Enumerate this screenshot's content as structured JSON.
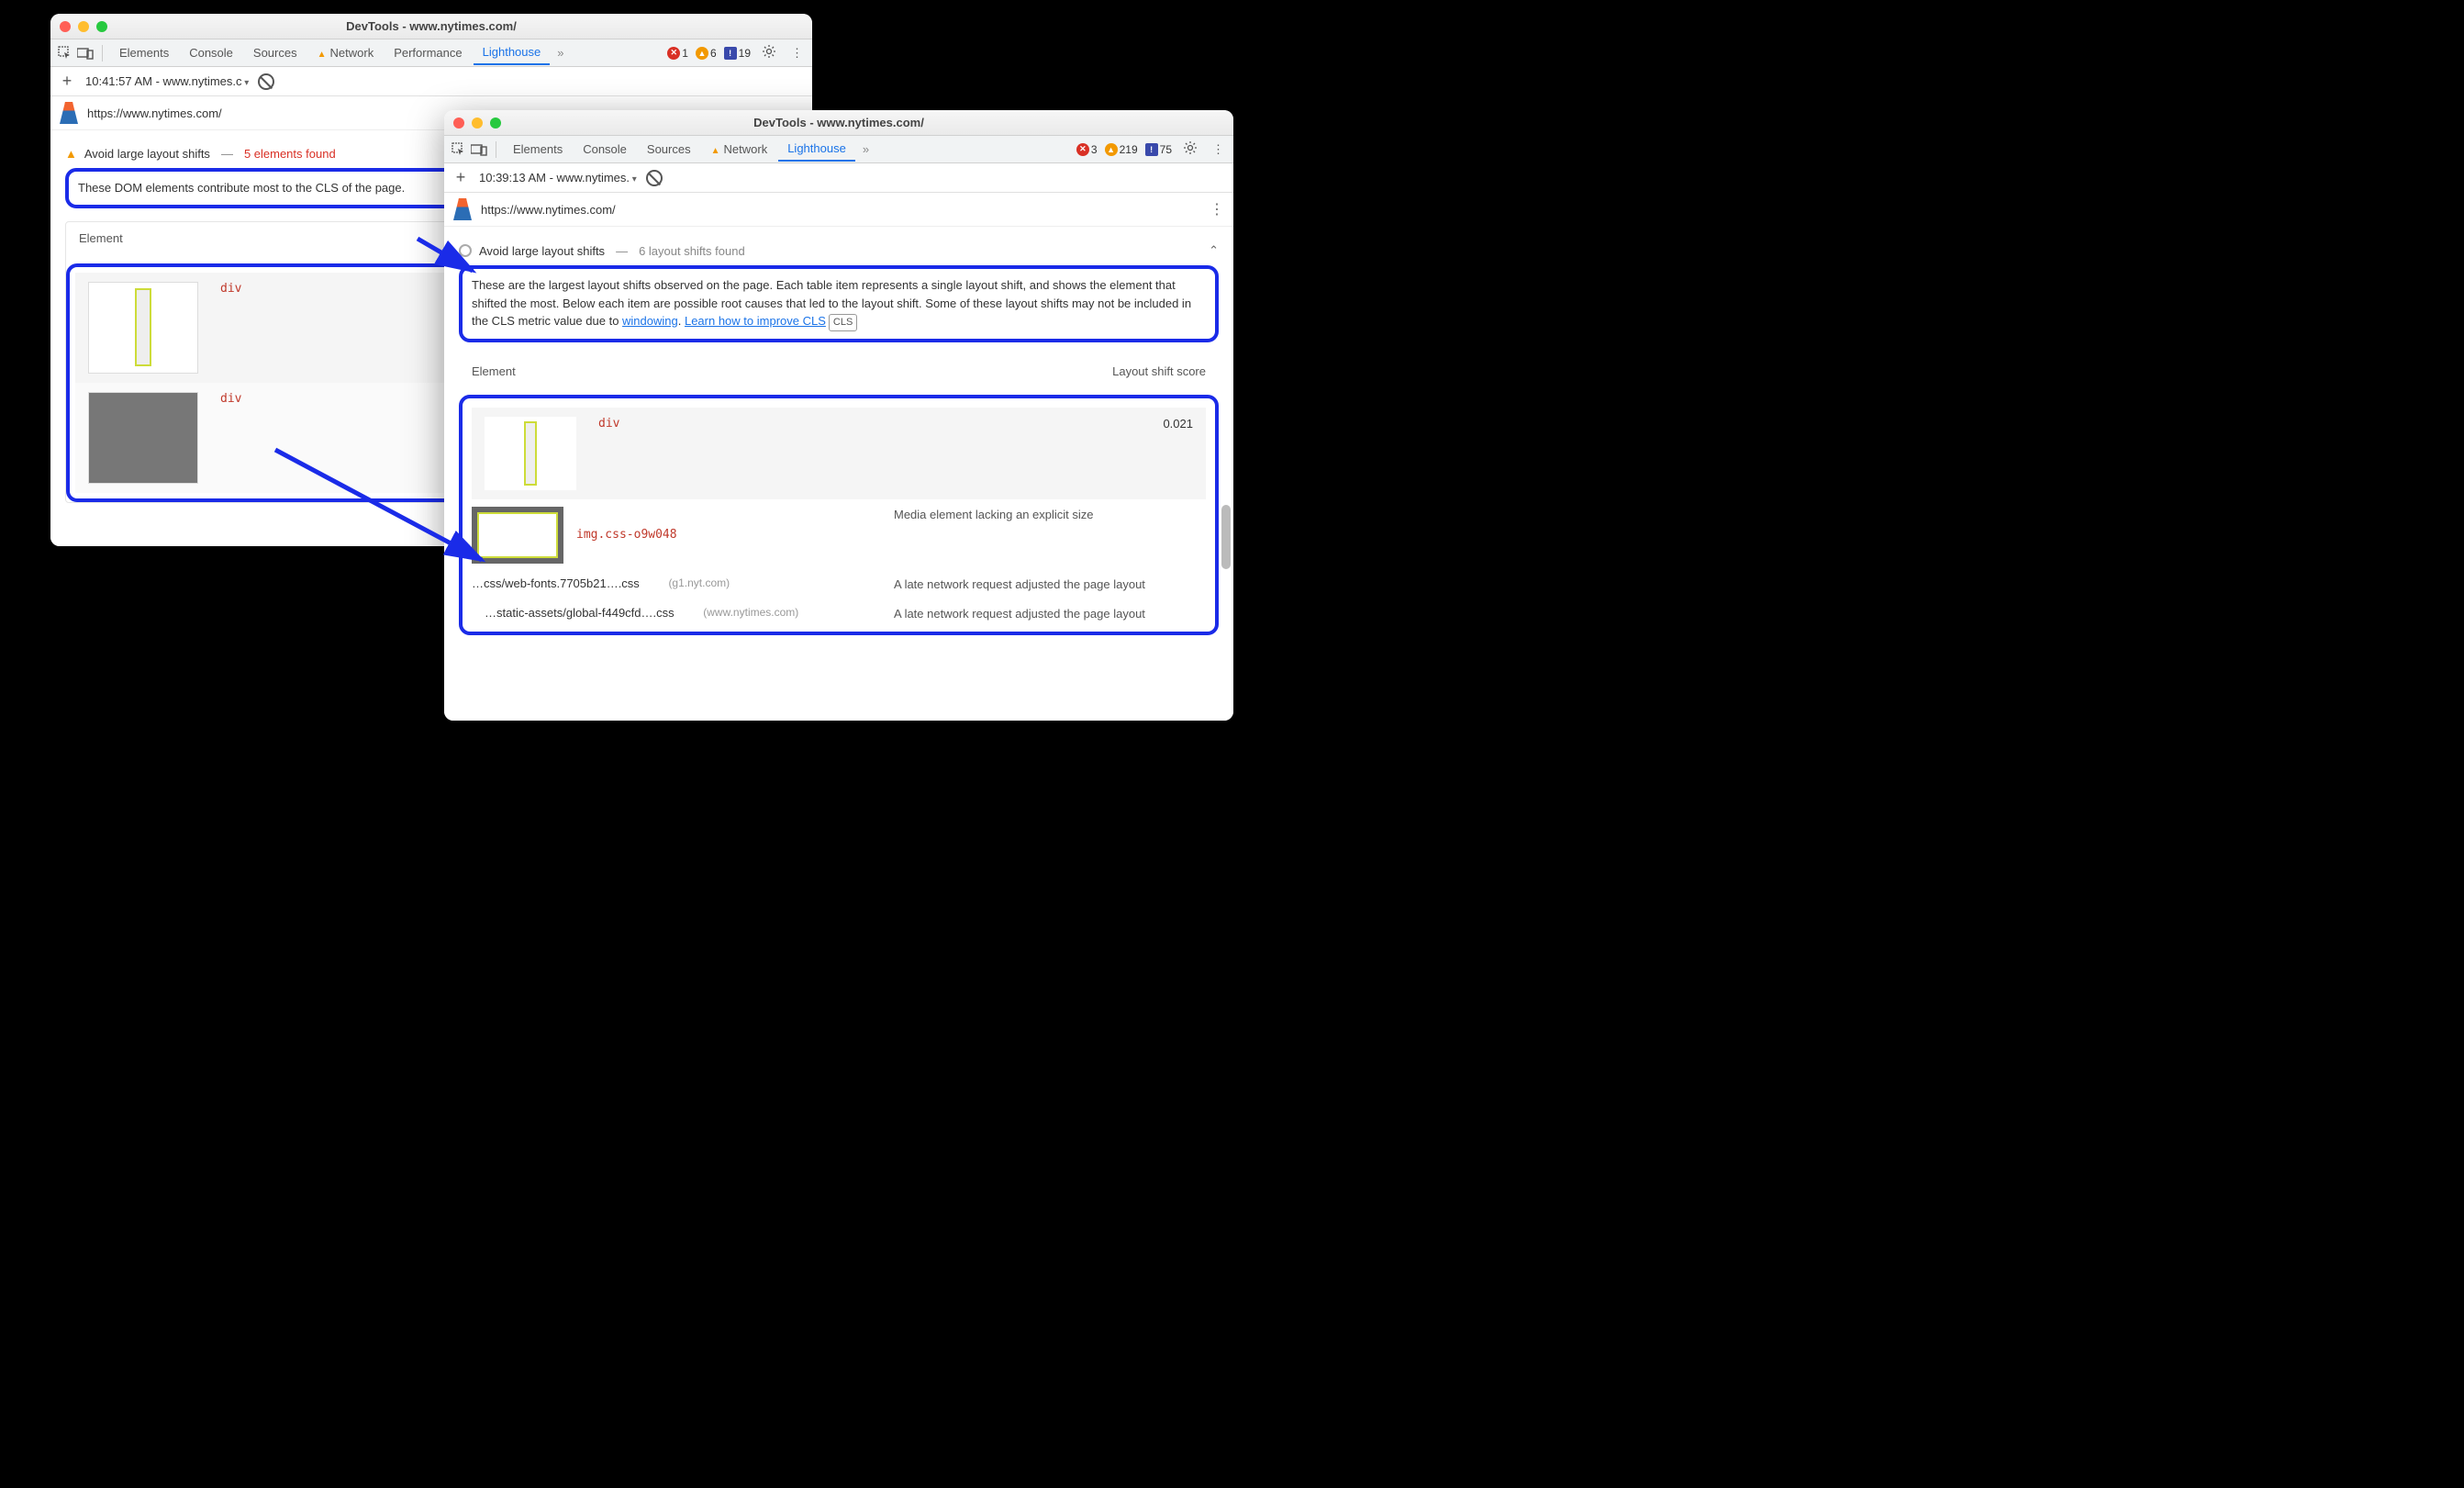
{
  "windows": {
    "back": {
      "title": "DevTools - www.nytimes.com/",
      "tabs": [
        "Elements",
        "Console",
        "Sources",
        "Network",
        "Performance",
        "Lighthouse"
      ],
      "active_tab": "Lighthouse",
      "warn_tab": "Network",
      "badges": {
        "errors": "1",
        "warnings": "6",
        "issues": "19"
      },
      "run_label": "10:41:57 AM - www.nytimes.c",
      "url": "https://www.nytimes.com/",
      "audit": {
        "title": "Avoid large layout shifts",
        "found": "5 elements found",
        "desc": "These DOM elements contribute most to the CLS of the page.",
        "table_header": "Element",
        "rows": [
          {
            "tag": "div"
          },
          {
            "tag": "div"
          }
        ]
      }
    },
    "front": {
      "title": "DevTools - www.nytimes.com/",
      "tabs": [
        "Elements",
        "Console",
        "Sources",
        "Network",
        "Lighthouse"
      ],
      "active_tab": "Lighthouse",
      "warn_tab": "Network",
      "badges": {
        "errors": "3",
        "warnings": "219",
        "issues": "75"
      },
      "run_label": "10:39:13 AM - www.nytimes.",
      "url": "https://www.nytimes.com/",
      "audit": {
        "title": "Avoid large layout shifts",
        "found": "6 layout shifts found",
        "desc_pre": "These are the largest layout shifts observed on the page. Each table item represents a single layout shift, and shows the element that shifted the most. Below each item are possible root causes that led to the layout shift. Some of these layout shifts may not be included in the CLS metric value due to ",
        "link1": "windowing",
        "desc_mid": ". ",
        "link2": "Learn how to improve CLS",
        "cls_badge": "CLS",
        "table_headers": {
          "left": "Element",
          "right": "Layout shift score"
        },
        "row1": {
          "tag": "div",
          "score": "0.021"
        },
        "causes": [
          {
            "tag": "img.css-o9w048",
            "reason": "Media element lacking an explicit size"
          },
          {
            "path": "…css/web-fonts.7705b21….css",
            "host": "(g1.nyt.com)",
            "reason": "A late network request adjusted the page layout"
          },
          {
            "path": "…static-assets/global-f449cfd….css",
            "host": "(www.nytimes.com)",
            "reason": "A late network request adjusted the page layout"
          }
        ]
      }
    }
  }
}
